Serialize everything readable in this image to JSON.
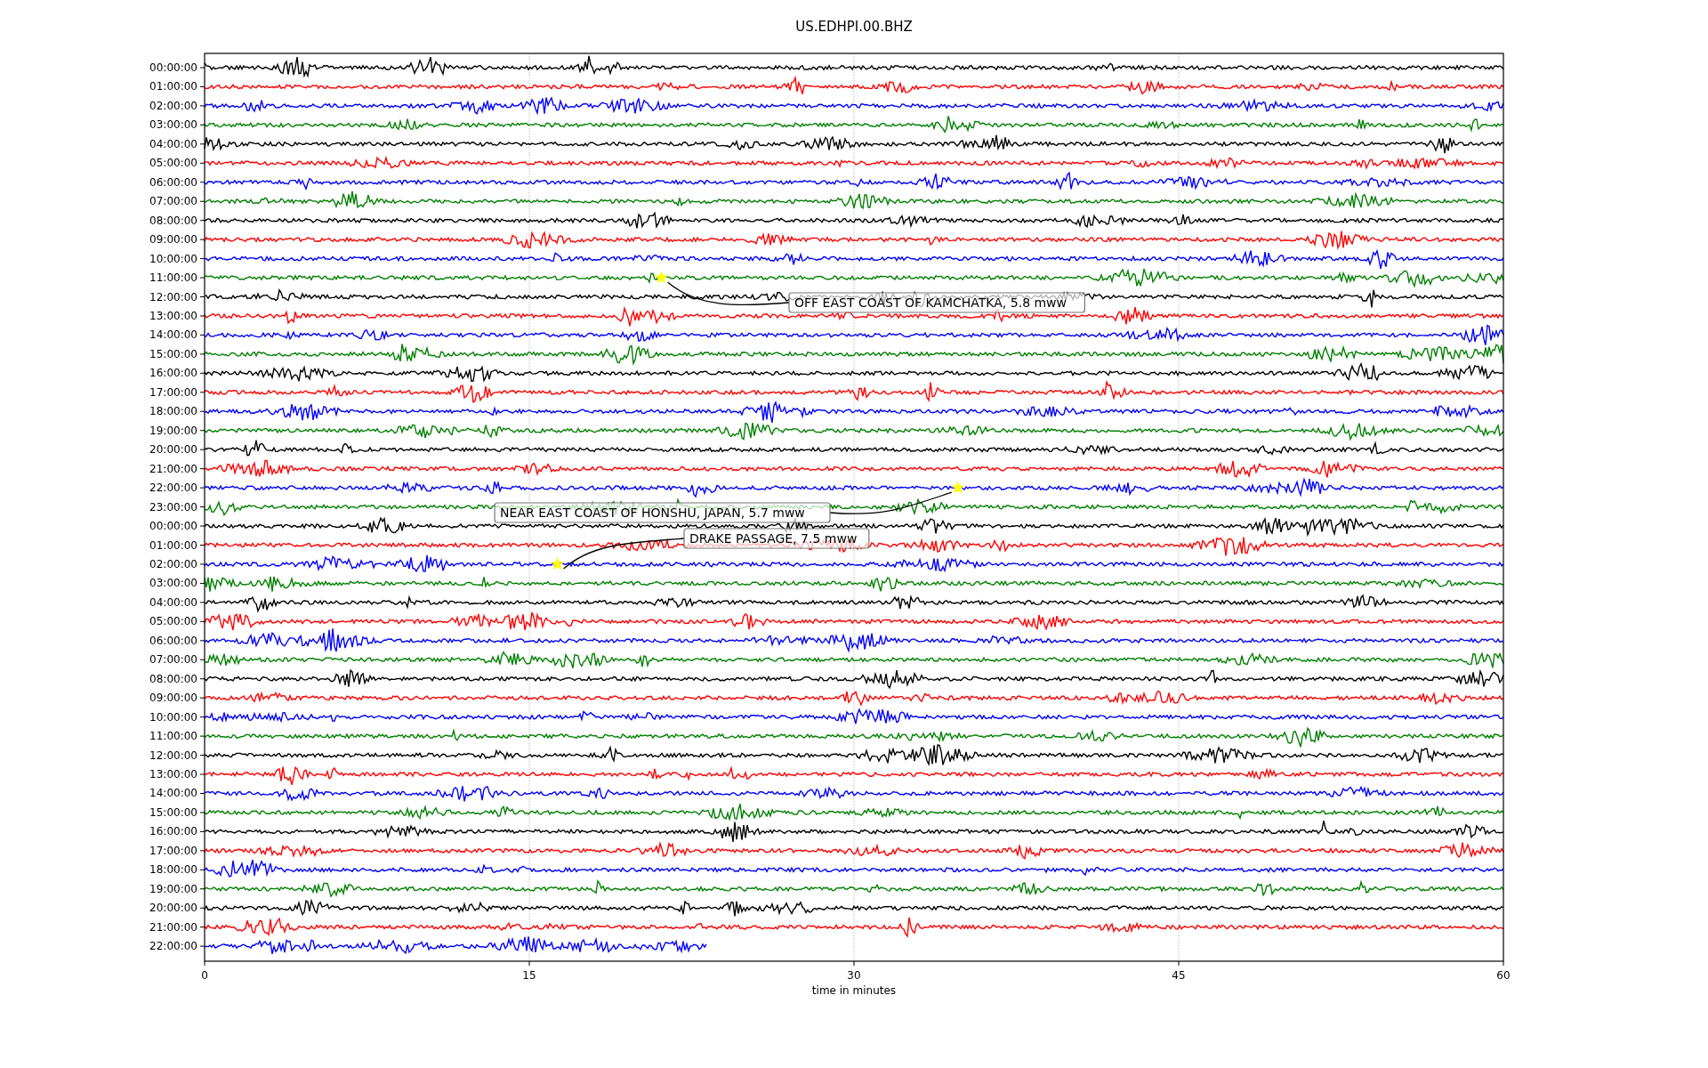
{
  "title": "US.EDHPI.00.BHZ",
  "rows": [
    {
      "label": "00:00:00",
      "color": "#000000"
    },
    {
      "label": "01:00:00",
      "color": "#ff0000"
    },
    {
      "label": "02:00:00",
      "color": "#0000ff"
    },
    {
      "label": "03:00:00",
      "color": "#008000"
    },
    {
      "label": "04:00:00",
      "color": "#000000"
    },
    {
      "label": "05:00:00",
      "color": "#ff0000"
    },
    {
      "label": "06:00:00",
      "color": "#0000ff"
    },
    {
      "label": "07:00:00",
      "color": "#008000"
    },
    {
      "label": "08:00:00",
      "color": "#000000"
    },
    {
      "label": "09:00:00",
      "color": "#ff0000"
    },
    {
      "label": "10:00:00",
      "color": "#0000ff"
    },
    {
      "label": "11:00:00",
      "color": "#008000"
    },
    {
      "label": "12:00:00",
      "color": "#000000"
    },
    {
      "label": "13:00:00",
      "color": "#ff0000"
    },
    {
      "label": "14:00:00",
      "color": "#0000ff"
    },
    {
      "label": "15:00:00",
      "color": "#008000"
    },
    {
      "label": "16:00:00",
      "color": "#000000"
    },
    {
      "label": "17:00:00",
      "color": "#ff0000"
    },
    {
      "label": "18:00:00",
      "color": "#0000ff"
    },
    {
      "label": "19:00:00",
      "color": "#008000"
    },
    {
      "label": "20:00:00",
      "color": "#000000"
    },
    {
      "label": "21:00:00",
      "color": "#ff0000"
    },
    {
      "label": "22:00:00",
      "color": "#0000ff"
    },
    {
      "label": "23:00:00",
      "color": "#008000"
    },
    {
      "label": "00:00:00",
      "color": "#000000"
    },
    {
      "label": "01:00:00",
      "color": "#ff0000"
    },
    {
      "label": "02:00:00",
      "color": "#0000ff"
    },
    {
      "label": "03:00:00",
      "color": "#008000"
    },
    {
      "label": "04:00:00",
      "color": "#000000"
    },
    {
      "label": "05:00:00",
      "color": "#ff0000"
    },
    {
      "label": "06:00:00",
      "color": "#0000ff"
    },
    {
      "label": "07:00:00",
      "color": "#008000"
    },
    {
      "label": "08:00:00",
      "color": "#000000"
    },
    {
      "label": "09:00:00",
      "color": "#ff0000"
    },
    {
      "label": "10:00:00",
      "color": "#0000ff"
    },
    {
      "label": "11:00:00",
      "color": "#008000"
    },
    {
      "label": "12:00:00",
      "color": "#000000"
    },
    {
      "label": "13:00:00",
      "color": "#ff0000"
    },
    {
      "label": "14:00:00",
      "color": "#0000ff"
    },
    {
      "label": "15:00:00",
      "color": "#008000"
    },
    {
      "label": "16:00:00",
      "color": "#000000"
    },
    {
      "label": "17:00:00",
      "color": "#ff0000"
    },
    {
      "label": "18:00:00",
      "color": "#0000ff"
    },
    {
      "label": "19:00:00",
      "color": "#008000"
    },
    {
      "label": "20:00:00",
      "color": "#000000"
    },
    {
      "label": "21:00:00",
      "color": "#ff0000"
    },
    {
      "label": "22:00:00",
      "color": "#0000ff"
    }
  ],
  "x_axis": {
    "ticks": [
      "0",
      "15",
      "30",
      "45",
      "60"
    ],
    "label": "time in minutes"
  },
  "events": [
    {
      "label": "OFF EAST COAST OF KAMCHATKA, 5.8 mww"
    },
    {
      "label": "NEAR EAST COAST OF HONSHU, JAPAN, 5.7 mww"
    },
    {
      "label": "DRAKE PASSAGE, 7.5 mww"
    }
  ]
}
